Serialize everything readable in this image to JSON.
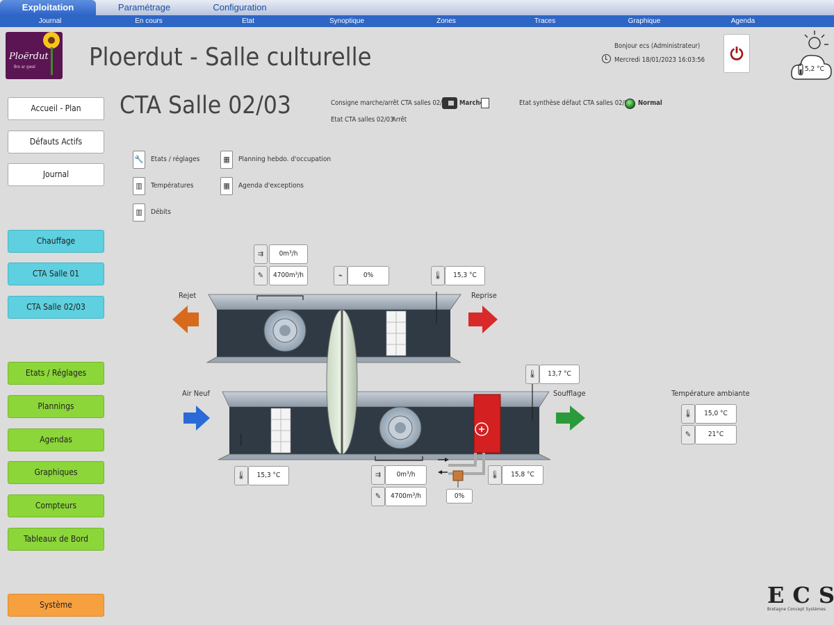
{
  "tabs": [
    "Exploitation",
    "Paramétrage",
    "Configuration"
  ],
  "subnav": [
    "Journal",
    "En cours",
    "Etat",
    "Synoptique",
    "Zones",
    "Traces",
    "Graphique",
    "Agenda"
  ],
  "header": {
    "title": "Ploerdut - Salle culturelle",
    "greeting": "Bonjour ecs (Administrateur)",
    "datetime": "Mercredi 18/01/2023 16:03:56",
    "outside_temp": "5,2 °C",
    "logo_text": "Ploërdut",
    "logo_sub": "Bro ar gwal"
  },
  "sidebar": {
    "white": [
      "Accueil - Plan",
      "Défauts Actifs",
      "Journal"
    ],
    "cyan": [
      "Chauffage",
      "CTA  Salle 01",
      "CTA  Salle 02/03"
    ],
    "green": [
      "Etats / Réglages",
      "Plannings",
      "Agendas",
      "Graphiques",
      "Compteurs",
      "Tableaux de Bord"
    ],
    "system": "Système"
  },
  "page": {
    "title": "CTA Salle 02/03",
    "consigne_label": "Consigne marche/arrêt CTA salles 02/03",
    "consigne_value": "Marche",
    "etat_label": "Etat CTA salles 02/03",
    "etat_value": "Arrêt",
    "synthese_label": "Etat synthèse défaut CTA salles 02/03",
    "synthese_value": "Normal"
  },
  "links": {
    "etats": "Etats / réglages",
    "temperatures": "Températures",
    "debits": "Débits",
    "planning": "Planning hebdo. d'occupation",
    "agenda": "Agenda d'exceptions"
  },
  "diagram": {
    "rejet": "Rejet",
    "reprise": "Reprise",
    "air_neuf": "Air Neuf",
    "soufflage": "Soufflage",
    "ext_fan_flow": "0m³/h",
    "ext_fan_set": "4700m³/h",
    "recup_pct": "0%",
    "reprise_temp": "15,3 °C",
    "soufflage_temp": "13,7 °C",
    "air_neuf_temp": "15,3 °C",
    "supply_fan_flow": "0m³/h",
    "supply_fan_set": "4700m³/h",
    "valve_pct": "0%",
    "heat_out_temp": "15,8 °C",
    "ambient_label": "Température ambiante",
    "ambient_temp": "15,0 °C",
    "ambient_set": "21°C"
  },
  "brand": {
    "letters": "ECS",
    "tagline": "Bretagne Concept Systèmes"
  },
  "colors": {
    "tab_blue": "#2e66c6",
    "cyan": "#5fd0e0",
    "green": "#8cd63a",
    "orange": "#f7a040",
    "heater_red": "#d42020"
  }
}
